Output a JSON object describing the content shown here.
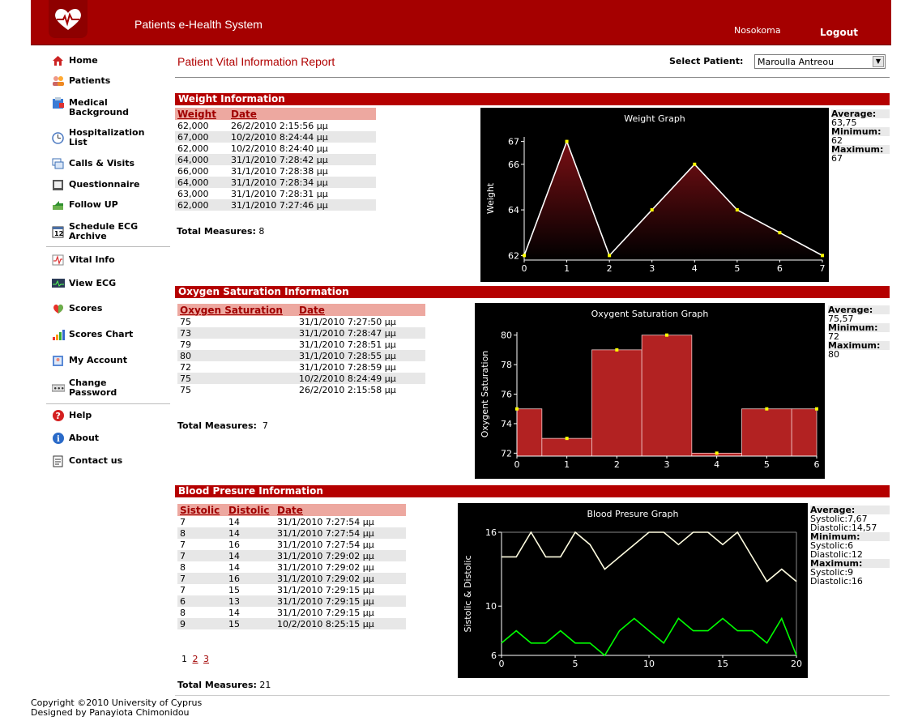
{
  "header": {
    "title": "Patients e-Health System",
    "user": "Nosokoma",
    "logout": "Logout"
  },
  "sidebar": {
    "items": [
      {
        "label": "Home",
        "icon": "home-icon"
      },
      {
        "label": "Patients",
        "icon": "patients-icon"
      },
      {
        "label": "Medical Background",
        "icon": "medical-icon"
      },
      {
        "label": "Hospitalization List",
        "icon": "clock-icon"
      },
      {
        "label": "Calls & Visits",
        "icon": "calls-icon"
      },
      {
        "label": "Questionnaire",
        "icon": "questionnaire-icon"
      },
      {
        "label": "Follow UP",
        "icon": "followup-icon"
      },
      {
        "label": "Schedule ECG Archive",
        "icon": "calendar-icon"
      },
      {
        "label": "Vital Info",
        "icon": "vital-icon"
      },
      {
        "label": "View ECG",
        "icon": "ecg-icon"
      },
      {
        "label": "Scores",
        "icon": "scores-icon"
      },
      {
        "label": "Scores Chart",
        "icon": "bar-chart-icon"
      },
      {
        "label": "My Account",
        "icon": "account-icon"
      },
      {
        "label": "Change Password",
        "icon": "password-icon"
      },
      {
        "label": "Help",
        "icon": "help-icon"
      },
      {
        "label": "About",
        "icon": "info-icon"
      },
      {
        "label": "Contact us",
        "icon": "contact-icon"
      }
    ]
  },
  "main": {
    "page_title": "Patient Vital Information Report",
    "select_label": "Select Patient:",
    "selected_patient": "Maroulla Antreou"
  },
  "weight": {
    "section_title": "Weight Information",
    "headers": [
      "Weight",
      "Date"
    ],
    "rows": [
      [
        "62,000",
        "26/2/2010 2:15:56 μμ"
      ],
      [
        "67,000",
        "10/2/2010 8:24:44 μμ"
      ],
      [
        "62,000",
        "10/2/2010 8:24:40 μμ"
      ],
      [
        "64,000",
        "31/1/2010 7:28:42 μμ"
      ],
      [
        "66,000",
        "31/1/2010 7:28:38 μμ"
      ],
      [
        "64,000",
        "31/1/2010 7:28:34 μμ"
      ],
      [
        "63,000",
        "31/1/2010 7:28:31 μμ"
      ],
      [
        "62,000",
        "31/1/2010 7:27:46 μμ"
      ]
    ],
    "total_label": "Total Measures:",
    "total": "8",
    "stats": {
      "average_label": "Average:",
      "average": "63,75",
      "minimum_label": "Minimum:",
      "minimum": "62",
      "maximum_label": "Maximum:",
      "maximum": "67"
    }
  },
  "oxygen": {
    "section_title": "Oxygen Saturation Information",
    "headers": [
      "Oxygen Saturation",
      "Date"
    ],
    "rows": [
      [
        "75",
        "31/1/2010 7:27:50 μμ"
      ],
      [
        "73",
        "31/1/2010 7:28:47 μμ"
      ],
      [
        "79",
        "31/1/2010 7:28:51 μμ"
      ],
      [
        "80",
        "31/1/2010 7:28:55 μμ"
      ],
      [
        "72",
        "31/1/2010 7:28:59 μμ"
      ],
      [
        "75",
        "10/2/2010 8:24:49 μμ"
      ],
      [
        "75",
        "26/2/2010 2:15:58 μμ"
      ]
    ],
    "total_label": "Total Measures:",
    "total": "7",
    "stats": {
      "average_label": "Average:",
      "average": "75,57",
      "minimum_label": "Minimum:",
      "minimum": "72",
      "maximum_label": "Maximum:",
      "maximum": "80"
    }
  },
  "blood": {
    "section_title": "Blood Presure Information",
    "headers": [
      "Sistolic",
      "Distolic",
      "Date"
    ],
    "rows": [
      [
        "7",
        "14",
        "31/1/2010 7:27:54 μμ"
      ],
      [
        "8",
        "14",
        "31/1/2010 7:27:54 μμ"
      ],
      [
        "7",
        "16",
        "31/1/2010 7:27:54 μμ"
      ],
      [
        "7",
        "14",
        "31/1/2010 7:29:02 μμ"
      ],
      [
        "8",
        "14",
        "31/1/2010 7:29:02 μμ"
      ],
      [
        "7",
        "16",
        "31/1/2010 7:29:02 μμ"
      ],
      [
        "7",
        "15",
        "31/1/2010 7:29:15 μμ"
      ],
      [
        "6",
        "13",
        "31/1/2010 7:29:15 μμ"
      ],
      [
        "8",
        "14",
        "31/1/2010 7:29:15 μμ"
      ],
      [
        "9",
        "15",
        "10/2/2010 8:25:15 μμ"
      ]
    ],
    "pages": [
      "1",
      "2",
      "3"
    ],
    "total_label": "Total Measures:",
    "total": "21",
    "stats": {
      "average_label": "Average:",
      "avg_sys": "Systolic:7,67",
      "avg_dia": "Diastolic:14,57",
      "minimum_label": "Minimum:",
      "min_sys": "Systolic:6",
      "min_dia": "Diastolic:12",
      "maximum_label": "Maximum:",
      "max_sys": "Systolic:9",
      "max_dia": "Diastolic:16"
    }
  },
  "footer": {
    "line1": "Copyright ©2010 University of Cyprus",
    "line2": "Designed by Panayiota Chimonidou"
  },
  "chart_data": [
    {
      "type": "area",
      "title": "Weight Graph",
      "xlabel": "",
      "ylabel": "Weight",
      "x": [
        0,
        1,
        2,
        3,
        4,
        5,
        6,
        7
      ],
      "values": [
        62,
        67,
        62,
        64,
        66,
        64,
        63,
        62
      ],
      "xlim": [
        0,
        7
      ],
      "ylim": [
        61.8,
        67.2
      ],
      "yticks": [
        62,
        64,
        66,
        67
      ],
      "colors": {
        "fill_top": "#7a0f14",
        "fill_bottom": "#000000",
        "line": "#ffffff",
        "marker": "#ffff00"
      }
    },
    {
      "type": "bar",
      "title": "Oxygent Saturation Graph",
      "xlabel": "",
      "ylabel": "Oxygent Saturation",
      "x": [
        0,
        1,
        2,
        3,
        4,
        5,
        6
      ],
      "values": [
        75,
        73,
        79,
        80,
        72,
        75,
        75
      ],
      "xlim": [
        0,
        6
      ],
      "ylim": [
        71.8,
        80.2
      ],
      "yticks": [
        72,
        74,
        76,
        78,
        80
      ],
      "colors": {
        "bar": "#b22222",
        "marker": "#ffff00"
      }
    },
    {
      "type": "line",
      "title": "Blood Presure Graph",
      "xlabel": "",
      "ylabel": "Sistolic & Distolic",
      "x": [
        0,
        1,
        2,
        3,
        4,
        5,
        6,
        7,
        8,
        9,
        10,
        11,
        12,
        13,
        14,
        15,
        16,
        17,
        18,
        19,
        20
      ],
      "series": [
        {
          "values": [
            14,
            14,
            16,
            14,
            14,
            16,
            15,
            13,
            14,
            15,
            16,
            16,
            15,
            16,
            16,
            15,
            16,
            14,
            12,
            13,
            12
          ],
          "color": "#fffde0"
        },
        {
          "values": [
            7,
            8,
            7,
            7,
            8,
            7,
            7,
            6,
            8,
            9,
            8,
            7,
            9,
            8,
            8,
            9,
            8,
            8,
            7,
            9,
            6
          ],
          "color": "#00ff00"
        }
      ],
      "xlim": [
        0,
        20
      ],
      "ylim": [
        6,
        16
      ],
      "xticks": [
        0,
        5,
        10,
        15,
        20
      ],
      "yticks": [
        6,
        10,
        16
      ]
    }
  ]
}
